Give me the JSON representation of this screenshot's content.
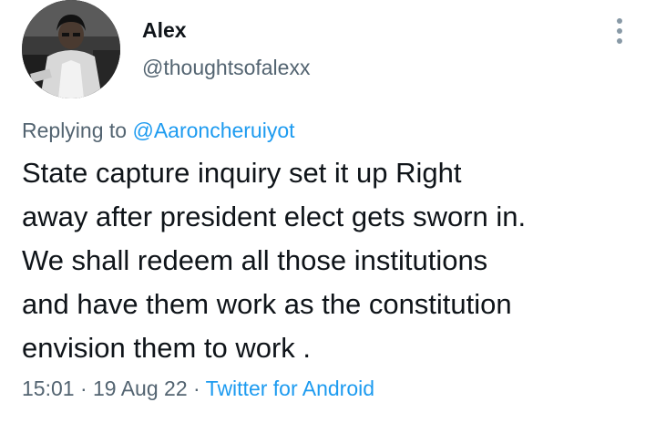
{
  "author": {
    "display_name": "Alex",
    "handle": "@thoughtsofalexx",
    "avatar_icon": "profile-photo"
  },
  "reply_context": {
    "prefix": "Replying to",
    "mention": "@Aaroncheruiyot"
  },
  "tweet": {
    "lines": [
      "State capture inquiry set it up Right",
      "away after president elect gets sworn in.",
      "We shall redeem all those institutions",
      "and have them work as the constitution",
      "envision them to work ."
    ]
  },
  "meta": {
    "time": "15:01",
    "date": "19 Aug 22",
    "separator": "·",
    "source": "Twitter for Android"
  },
  "colors": {
    "text": "#0f1419",
    "secondary": "#536471",
    "link": "#1d9bf0"
  },
  "icons": {
    "more": "more-vertical-icon"
  }
}
